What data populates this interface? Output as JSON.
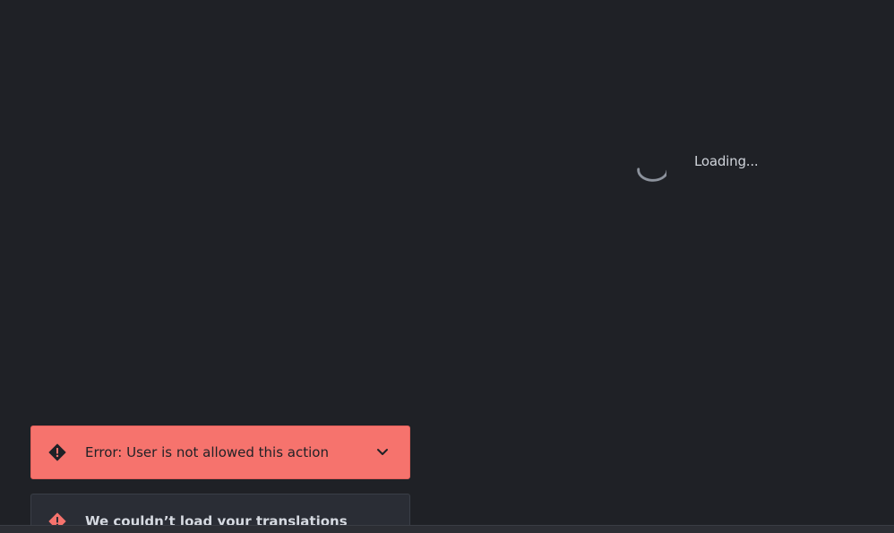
{
  "loading": {
    "label": "Loading...",
    "spinner_icon": "spinner-icon",
    "text_color": "#cfd3da"
  },
  "notifications": [
    {
      "level": "error",
      "icon": "alert-diamond-icon",
      "message": "Error: User is not allowed this action",
      "expand_icon": "chevron-down-icon",
      "background": "#f6736d"
    },
    {
      "level": "error",
      "icon": "alert-diamond-icon",
      "message": "We couldn’t load your translations",
      "background": "#2a2d35"
    }
  ],
  "theme": {
    "background": "#1f2126",
    "error_accent": "#f6736d"
  }
}
